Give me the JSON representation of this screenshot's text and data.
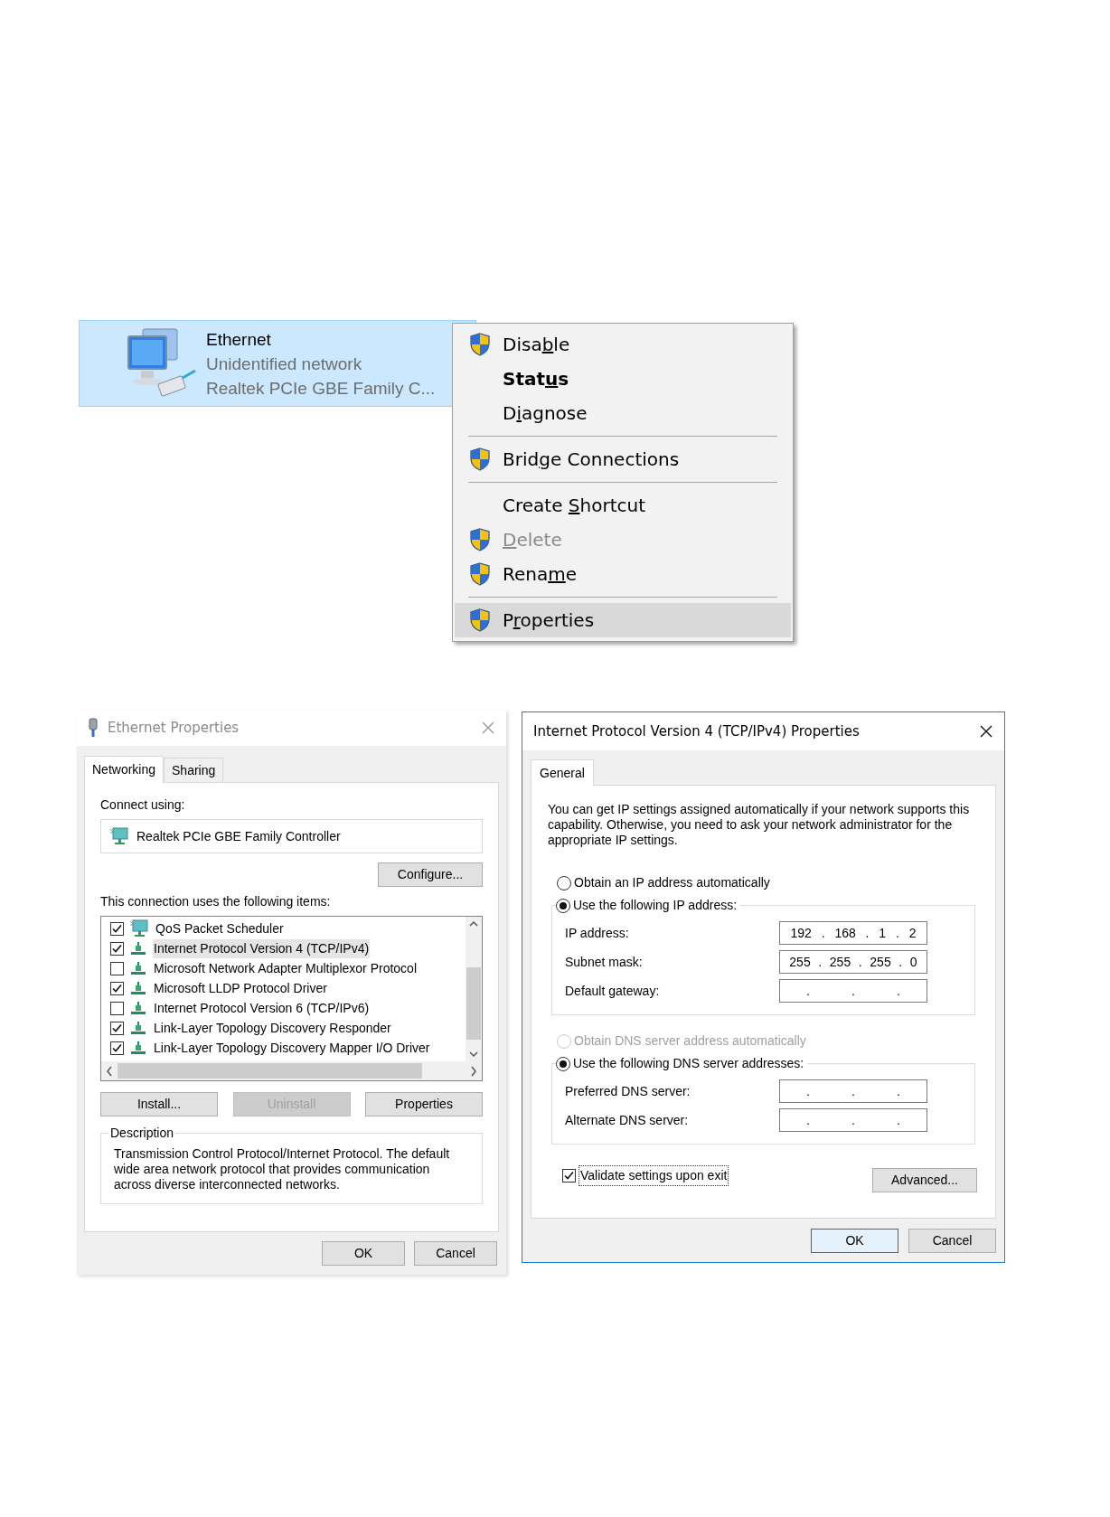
{
  "connection_tile": {
    "selected": true,
    "name": "Ethernet",
    "status": "Unidentified network",
    "device": "Realtek PCIe GBE Family C..."
  },
  "context_menu": {
    "items": [
      {
        "kind": "item",
        "before": "Disa",
        "key": "b",
        "after": "le",
        "shield": true,
        "default": false,
        "disabled": false,
        "selected": false
      },
      {
        "kind": "item",
        "before": "Stat",
        "key": "u",
        "after": "s",
        "shield": false,
        "default": true,
        "disabled": false,
        "selected": false
      },
      {
        "kind": "item",
        "before": "D",
        "key": "i",
        "after": "agnose",
        "shield": false,
        "default": false,
        "disabled": false,
        "selected": false
      },
      {
        "kind": "separator"
      },
      {
        "kind": "item",
        "before": "Brid",
        "key": "g",
        "after": "e Connections",
        "shield": true,
        "default": false,
        "disabled": false,
        "selected": false
      },
      {
        "kind": "separator"
      },
      {
        "kind": "item",
        "before": "Create ",
        "key": "S",
        "after": "hortcut",
        "shield": false,
        "default": false,
        "disabled": false,
        "selected": false
      },
      {
        "kind": "item",
        "key": "D",
        "after": "elete",
        "shield": true,
        "default": false,
        "disabled": true,
        "selected": false
      },
      {
        "kind": "item",
        "before": "Rena",
        "key": "m",
        "after": "e",
        "shield": true,
        "default": false,
        "disabled": false,
        "selected": false
      },
      {
        "kind": "separator"
      },
      {
        "kind": "item",
        "before": "P",
        "key": "r",
        "after": "operties",
        "shield": true,
        "default": false,
        "disabled": false,
        "selected": true
      }
    ]
  },
  "ethernet_properties": {
    "title": "Ethernet Properties",
    "active": false,
    "tabs": [
      {
        "label": "Networking",
        "selected": true
      },
      {
        "label": "Sharing",
        "selected": false
      }
    ],
    "connect_using_label": "Connect using:",
    "adapter": "Realtek PCIe GBE Family Controller",
    "configure_button": "Configure...",
    "items_label": "This connection uses the following items:",
    "items": [
      {
        "kind": "scheduler",
        "label": "QoS Packet Scheduler",
        "checked": true,
        "selected": false
      },
      {
        "kind": "protocol",
        "label": "Internet Protocol Version 4 (TCP/IPv4)",
        "checked": true,
        "selected": true
      },
      {
        "kind": "protocol",
        "label": "Microsoft Network Adapter Multiplexor Protocol",
        "checked": false,
        "selected": false
      },
      {
        "kind": "protocol",
        "label": "Microsoft LLDP Protocol Driver",
        "checked": true,
        "selected": false
      },
      {
        "kind": "protocol",
        "label": "Internet Protocol Version 6 (TCP/IPv6)",
        "checked": false,
        "selected": false
      },
      {
        "kind": "protocol",
        "label": "Link-Layer Topology Discovery Responder",
        "checked": true,
        "selected": false
      },
      {
        "kind": "protocol",
        "label": "Link-Layer Topology Discovery Mapper I/O Driver",
        "checked": true,
        "selected": false
      }
    ],
    "item_buttons": [
      {
        "label": "Install...",
        "disabled": false
      },
      {
        "label": "Uninstall",
        "disabled": true
      },
      {
        "label": "Properties",
        "disabled": false
      }
    ],
    "description_label": "Description",
    "description": "Transmission Control Protocol/Internet Protocol. The default wide area network protocol that provides communication across diverse interconnected networks.",
    "buttons": [
      {
        "label": "OK",
        "default": false
      },
      {
        "label": "Cancel",
        "default": false
      }
    ]
  },
  "ipv4_properties": {
    "title": "Internet Protocol Version 4 (TCP/IPv4) Properties",
    "active": true,
    "tabs": [
      {
        "label": "General",
        "selected": true
      }
    ],
    "intro": "You can get IP settings assigned automatically if your network supports this capability. Otherwise, you need to ask your network administrator for the appropriate IP settings.",
    "ip_options": [
      {
        "label": "Obtain an IP address automatically",
        "selected": false,
        "disabled": false
      },
      {
        "label": "Use the following IP address:",
        "selected": true,
        "disabled": false
      }
    ],
    "ip_fields": [
      {
        "label": "IP address:",
        "value": "192 . 168 . 1 . 2"
      },
      {
        "label": "Subnet mask:",
        "value": "255 . 255 . 255 . 0"
      },
      {
        "label": "Default gateway:",
        "value": ". . ."
      }
    ],
    "dns_options": [
      {
        "label": "Obtain DNS server address automatically",
        "selected": false,
        "disabled": true
      },
      {
        "label": "Use the following DNS server addresses:",
        "selected": true,
        "disabled": false
      }
    ],
    "dns_fields": [
      {
        "label": "Preferred DNS server:",
        "value": ". . ."
      },
      {
        "label": "Alternate DNS server:",
        "value": ". . ."
      }
    ],
    "validate": {
      "label": "Validate settings upon exit",
      "checked": true
    },
    "advanced_button": "Advanced...",
    "buttons": [
      {
        "label": "OK",
        "default": true
      },
      {
        "label": "Cancel",
        "default": false
      }
    ]
  }
}
